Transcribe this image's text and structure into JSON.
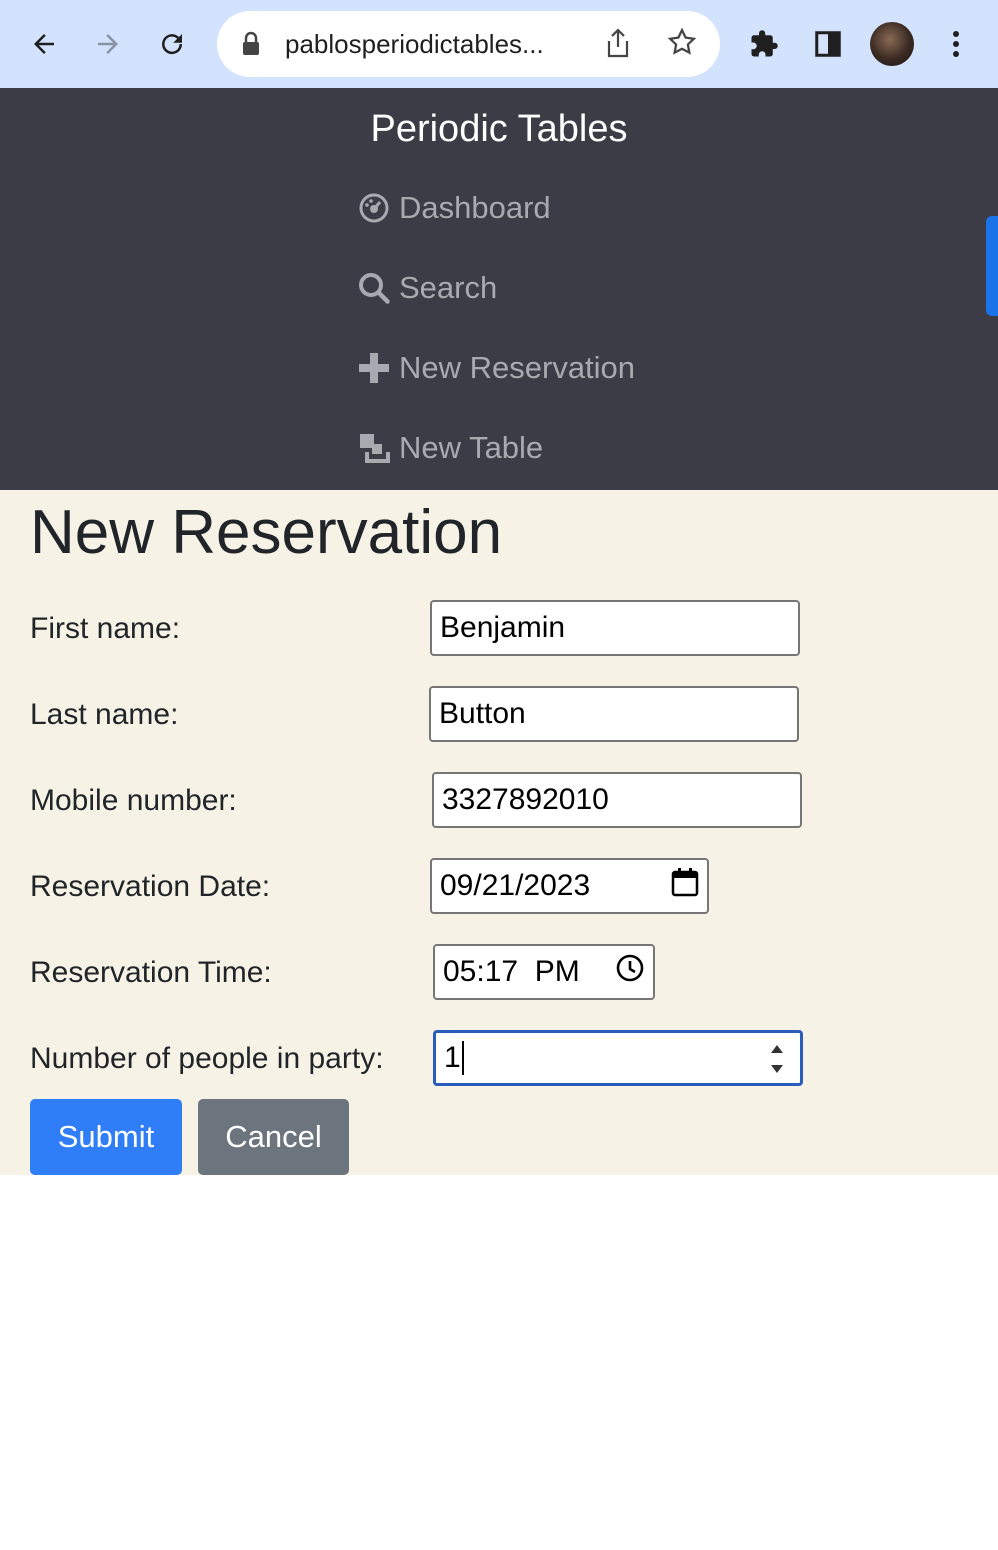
{
  "browser": {
    "url": "pablosperiodictables..."
  },
  "nav": {
    "brand": "Periodic Tables",
    "items": [
      {
        "label": "Dashboard",
        "icon": "dashboard-icon"
      },
      {
        "label": "Search",
        "icon": "search-icon"
      },
      {
        "label": "New Reservation",
        "icon": "plus-icon"
      },
      {
        "label": "New Table",
        "icon": "layers-icon"
      }
    ]
  },
  "form": {
    "title": "New Reservation",
    "first_name": {
      "label": "First name:",
      "value": "Benjamin"
    },
    "last_name": {
      "label": "Last name:",
      "value": "Button"
    },
    "mobile_number": {
      "label": "Mobile number:",
      "value": "3327892010"
    },
    "reservation_date": {
      "label": "Reservation Date:",
      "value": "09/21/2023"
    },
    "reservation_time": {
      "label": "Reservation Time:",
      "value": "05:17  PM"
    },
    "people": {
      "label": "Number of people in party:",
      "value": "1"
    },
    "submit_label": "Submit",
    "cancel_label": "Cancel"
  },
  "colors": {
    "nav_bg": "#3c3c46",
    "page_bg": "#f6f3e6",
    "primary": "#2f7ef7",
    "secondary": "#6c757d"
  }
}
